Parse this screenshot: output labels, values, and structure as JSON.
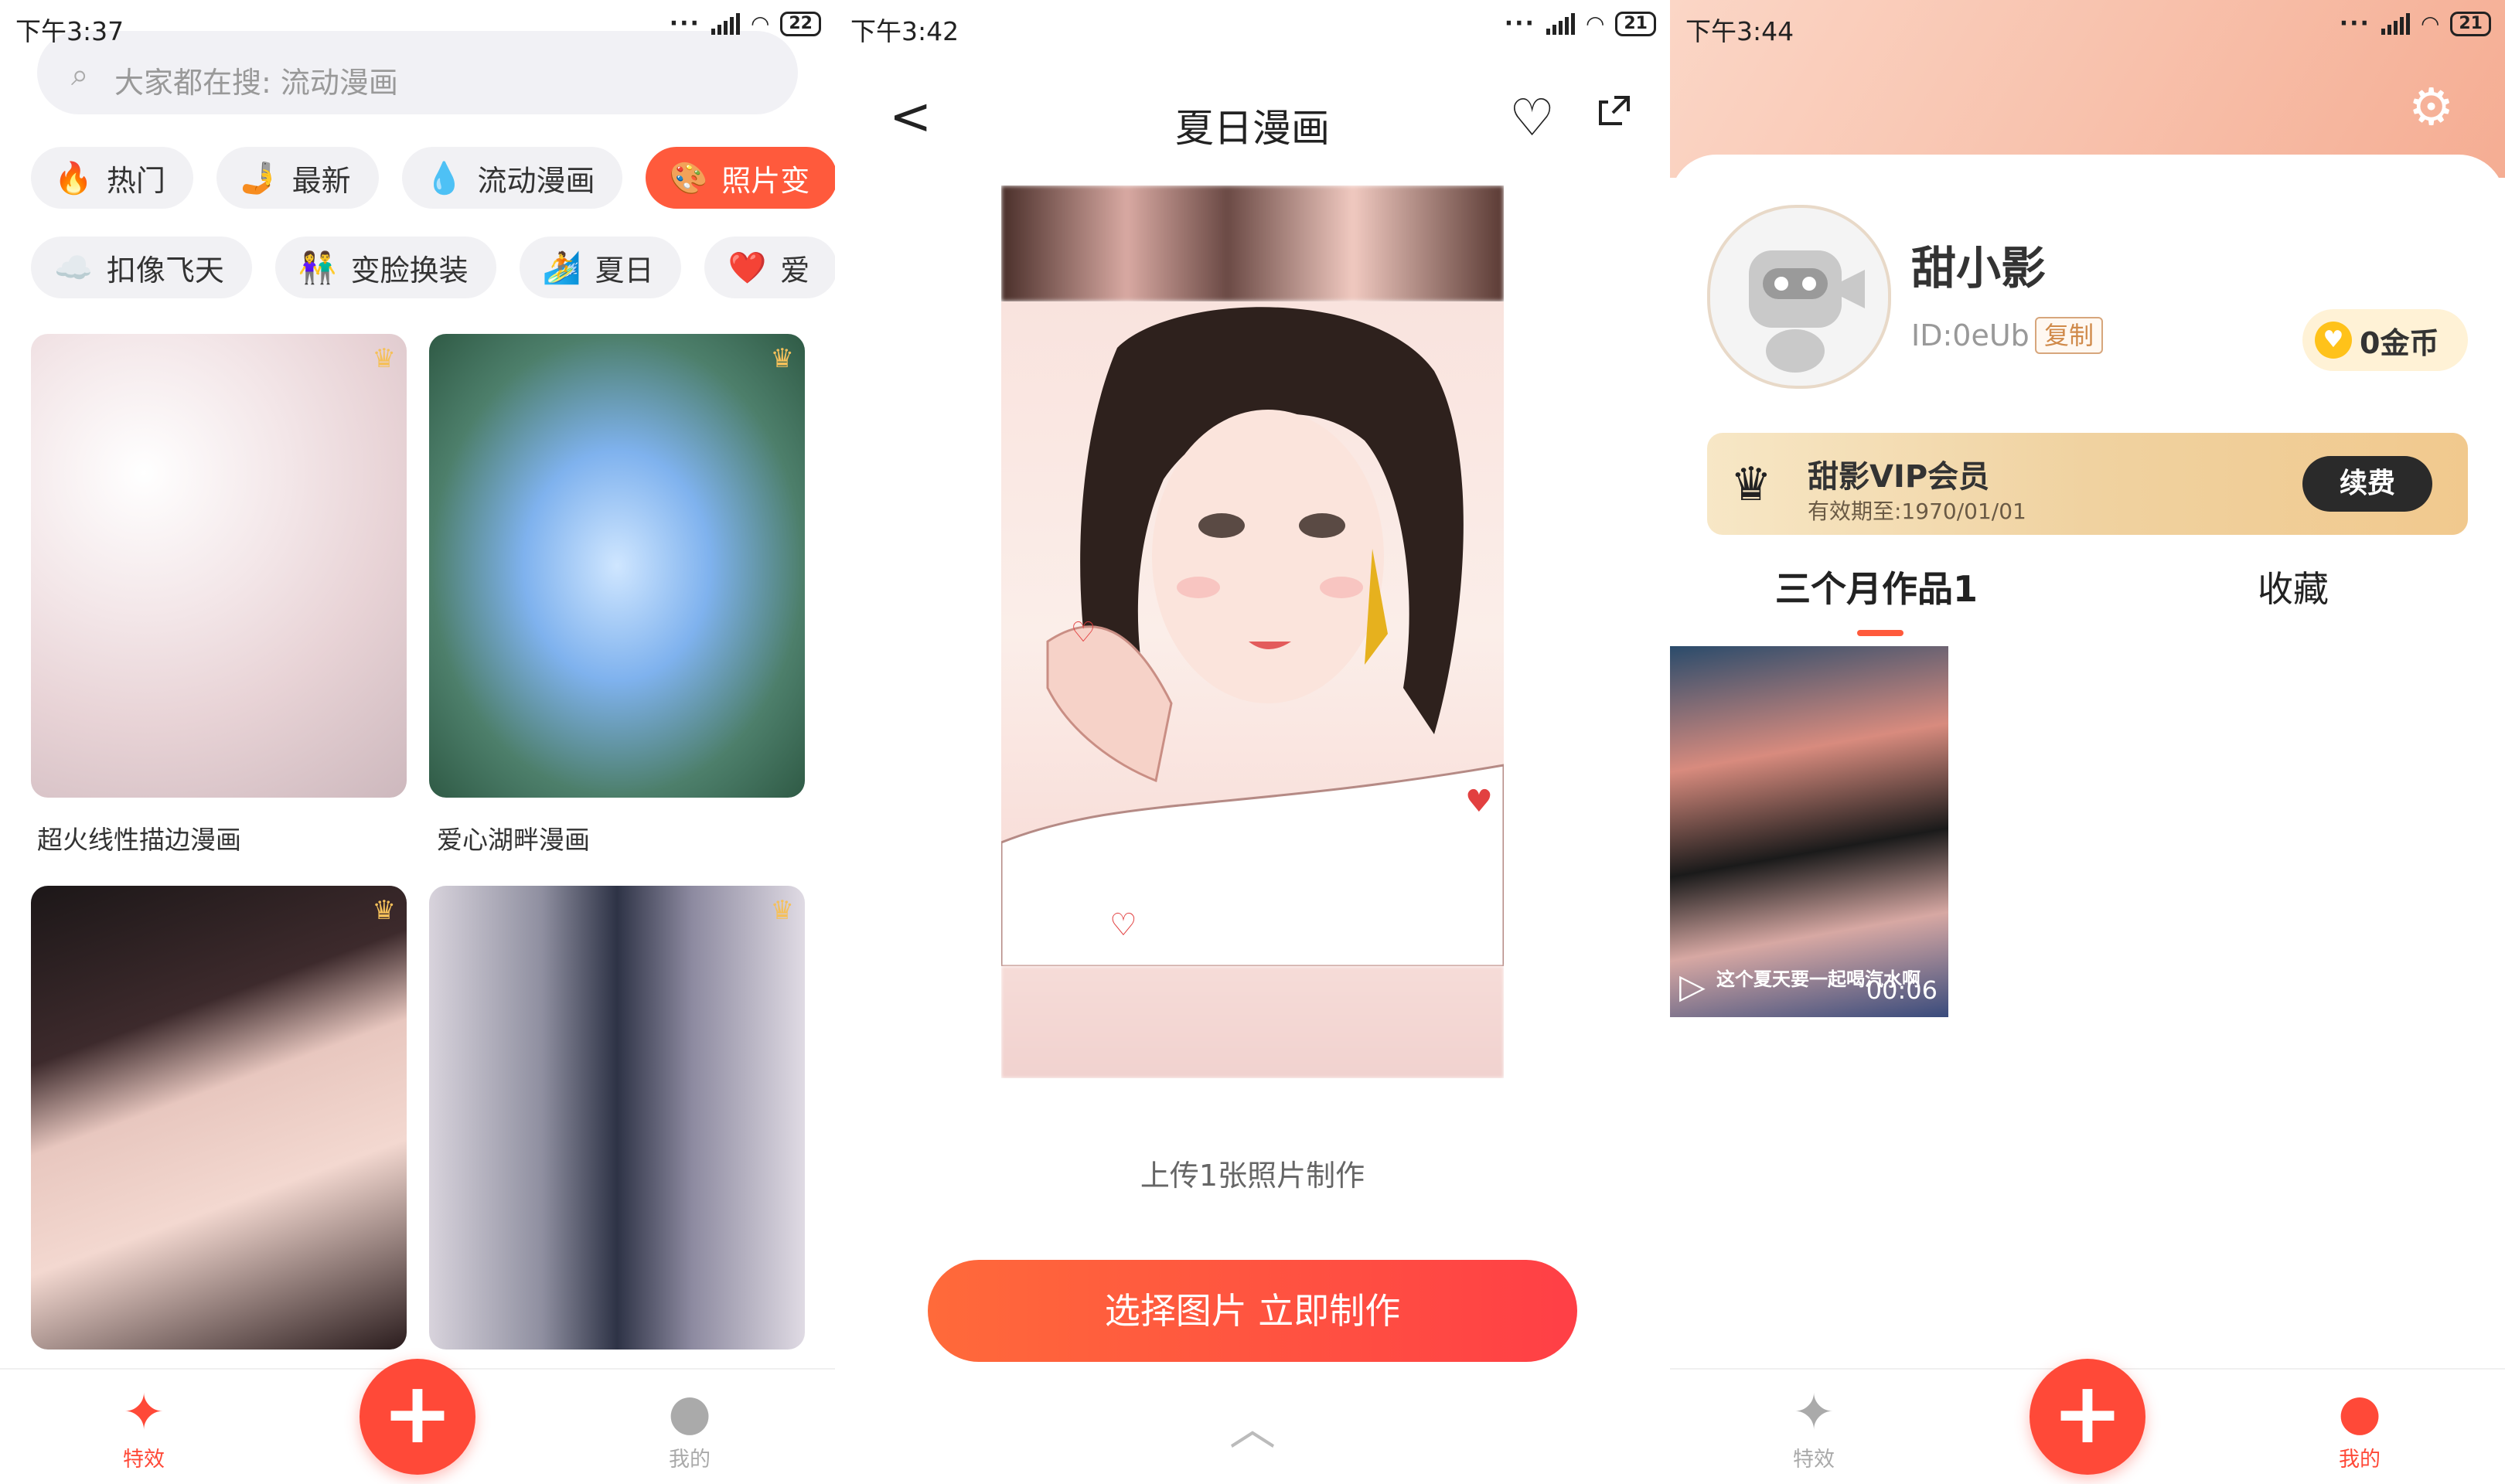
{
  "panel1": {
    "status": {
      "time": "下午3:37",
      "battery": "22"
    },
    "search": {
      "placeholder": "大家都在搜: 流动漫画"
    },
    "chips_row1": [
      {
        "icon": "🔥",
        "label": "热门"
      },
      {
        "icon": "🤳",
        "label": "最新"
      },
      {
        "icon": "💧",
        "label": "流动漫画"
      },
      {
        "icon": "🎨",
        "label": "照片变"
      }
    ],
    "chips_row2": [
      {
        "icon": "☁️",
        "label": "扣像飞天"
      },
      {
        "icon": "👫",
        "label": "变脸换装"
      },
      {
        "icon": "🏄",
        "label": "夏日"
      },
      {
        "icon": "❤️",
        "label": "爱"
      }
    ],
    "cards": [
      {
        "caption": "超火线性描边漫画"
      },
      {
        "caption": "爱心湖畔漫画"
      },
      {
        "caption": ""
      },
      {
        "caption": ""
      }
    ],
    "tabbar": {
      "effects_label": "特效",
      "mine_label": "我的",
      "fab_label": "+"
    }
  },
  "panel2": {
    "status": {
      "time": "下午3:42",
      "battery": "21"
    },
    "title": "夏日漫画",
    "upload_hint": "上传1张照片制作",
    "make_button": "选择图片 立即制作"
  },
  "panel3": {
    "status": {
      "time": "下午3:44",
      "battery": "21"
    },
    "user": {
      "name": "甜小影",
      "id": "ID:0eUb",
      "copy_label": "复制",
      "coins": "0金币"
    },
    "vip": {
      "title": "甜影VIP会员",
      "expiry": "有效期至:1970/01/01",
      "renew_label": "续费"
    },
    "tabs": {
      "works": "三个月作品1",
      "favorites": "收藏"
    },
    "work": {
      "duration": "00:06",
      "caption": "这个夏天要一起喝汽水啊"
    },
    "tabbar": {
      "effects_label": "特效",
      "mine_label": "我的",
      "fab_label": "+"
    }
  },
  "colors": {
    "accent": "#ff4938",
    "vip_gold": "#f0d2a0",
    "coin": "#ffc21a"
  }
}
